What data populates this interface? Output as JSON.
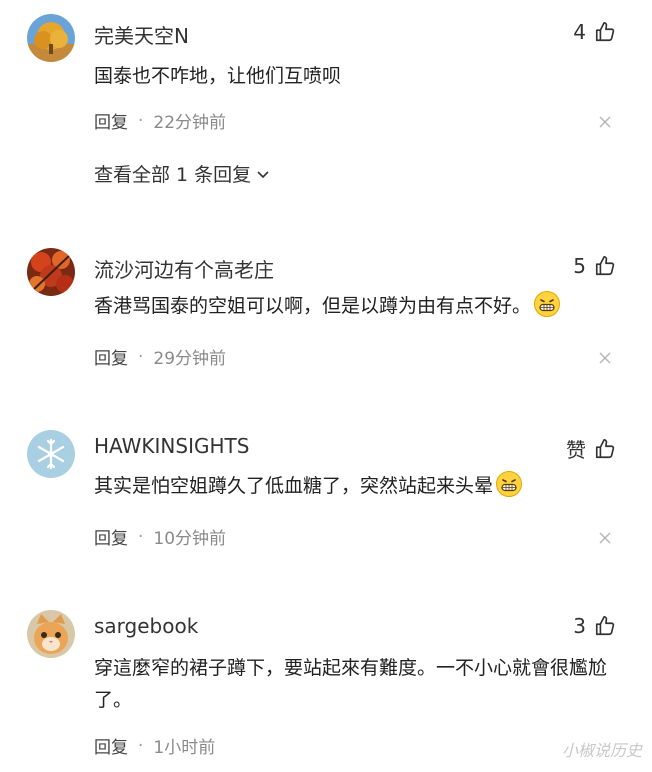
{
  "comments": [
    {
      "username": "完美天空N",
      "likes": "4",
      "content": "国泰也不咋地，让他们互喷呗",
      "reply_label": "回复",
      "separator": "·",
      "time": "22分钟前",
      "avatar_icon": "autumn-tree-photo"
    },
    {
      "username": "流沙河边有个高老庄",
      "likes": "5",
      "content": "香港骂国泰的空姐可以啊，但是以蹲为由有点不好。",
      "reply_label": "回复",
      "separator": "·",
      "time": "29分钟前",
      "avatar_icon": "red-leaves-photo"
    },
    {
      "username": "HAWKINSIGHTS",
      "likes": "赞",
      "content": "其实是怕空姐蹲久了低血糖了，突然站起来头晕",
      "reply_label": "回复",
      "separator": "·",
      "time": "10分钟前",
      "avatar_icon": "snowflake-icon"
    },
    {
      "username": "sargebook",
      "likes": "3",
      "content": "穿這麼窄的裙子蹲下，要站起來有難度。一不小心就會很尷尬了。",
      "reply_label": "回复",
      "separator": "·",
      "time": "1小时前",
      "avatar_icon": "kitten-photo"
    }
  ],
  "view_all_replies": "查看全部 1 条回复",
  "watermark": "小椒说历史",
  "colors": {
    "text": "#222222",
    "meta": "#8a8a8a",
    "icon": "#333333",
    "close": "#b8b8b8"
  }
}
